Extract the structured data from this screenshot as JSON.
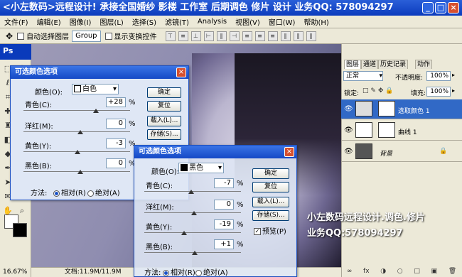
{
  "title": "<小左数码>远程设计! 承接全国婚纱 影楼 工作室 后期调色 修片 设计 业务QQ: 578094297",
  "window_buttons": [
    "_",
    "□",
    "×"
  ],
  "menu": [
    "文件(F)",
    "编辑(E)",
    "图像(I)",
    "图层(L)",
    "选择(S)",
    "滤镜(T)",
    "Analysis",
    "视图(V)",
    "窗口(W)",
    "帮助(H)"
  ],
  "options": {
    "autoselect_label": "自动选择图层",
    "group_value": "Group",
    "show_transform_label": "显示变换控件"
  },
  "toolbox": {
    "title": "Ps"
  },
  "status": {
    "zoom": "16.67%",
    "doc": "文档:11.9M/11.9M"
  },
  "dialog1": {
    "title": "可选颜色选项",
    "color_label": "颜色(O):",
    "color_value": "白色",
    "rows": [
      {
        "label": "青色(C):",
        "value": "+28",
        "unit": "%",
        "pos": 0.64
      },
      {
        "label": "洋红(M):",
        "value": "0",
        "unit": "%",
        "pos": 0.5
      },
      {
        "label": "黄色(Y):",
        "value": "-3",
        "unit": "%",
        "pos": 0.48
      },
      {
        "label": "黑色(B):",
        "value": "0",
        "unit": "%",
        "pos": 0.5
      }
    ],
    "buttons": {
      "ok": "确定",
      "reset": "复位",
      "load": "载入(L)...",
      "save": "存储(S)..."
    },
    "method_label": "方法:",
    "relative": "相对(R)",
    "absolute": "绝对(A)"
  },
  "dialog2": {
    "title": "可选颜色选项",
    "color_label": "颜色(O):",
    "color_value": "黑色",
    "rows": [
      {
        "label": "青色(C):",
        "value": "-7",
        "unit": "%",
        "pos": 0.46
      },
      {
        "label": "洋红(M):",
        "value": "0",
        "unit": "%",
        "pos": 0.5
      },
      {
        "label": "黄色(Y):",
        "value": "-19",
        "unit": "%",
        "pos": 0.4
      },
      {
        "label": "黑色(B):",
        "value": "+1",
        "unit": "%",
        "pos": 0.51
      }
    ],
    "buttons": {
      "ok": "确定",
      "reset": "复位",
      "load": "载入(L)...",
      "save": "存储(S)..."
    },
    "preview": "预览(P)",
    "method_label": "方法:",
    "relative": "相对(R)",
    "absolute": "绝对(A)"
  },
  "panel": {
    "tabs": [
      "图层",
      "通道",
      "历史记录",
      "动作"
    ],
    "blend_mode": "正常",
    "opacity_label": "不透明度:",
    "opacity_value": "100%",
    "lock_label": "锁定:",
    "fill_label": "填充:",
    "fill_value": "100%",
    "layers": [
      {
        "name": "选取颜色 1",
        "selected": true
      },
      {
        "name": "曲线 1",
        "selected": false
      },
      {
        "name": "背景",
        "selected": false
      }
    ],
    "bottom_icons": [
      "∞",
      "fx",
      "◑",
      "○",
      "□",
      "▣",
      "🗑"
    ]
  },
  "watermark": {
    "line1": "小左数码远程设计.调色.修片",
    "line2": "业务QQ:578094297"
  }
}
